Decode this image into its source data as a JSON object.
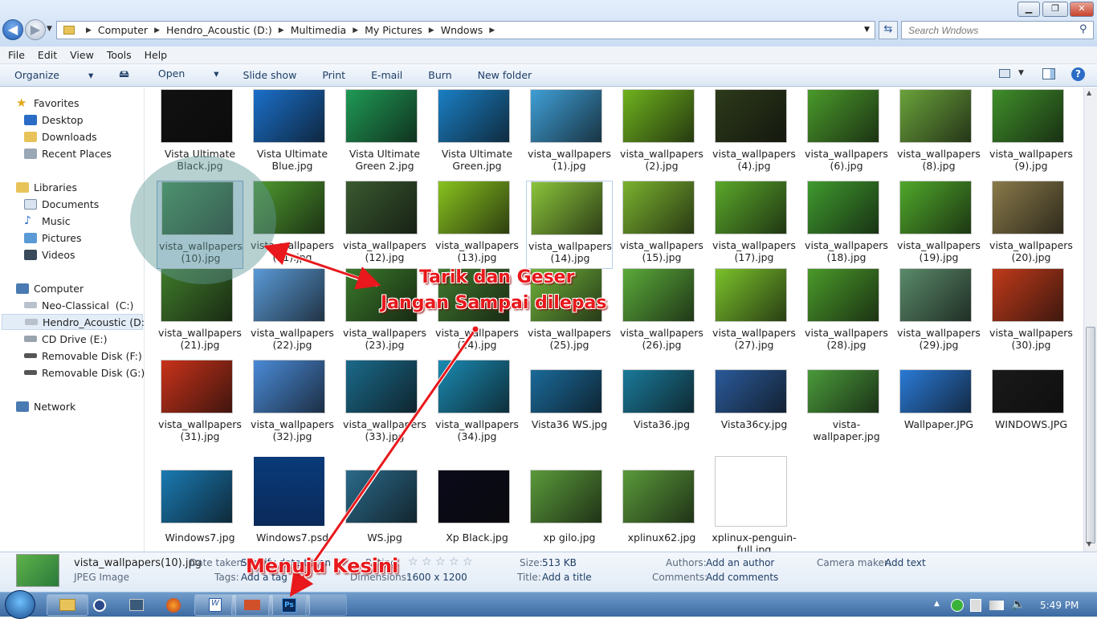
{
  "breadcrumb": [
    "Computer",
    "Hendro_Acoustic (D:)",
    "Multimedia",
    "My Pictures",
    "Wndows"
  ],
  "search_placeholder": "Search Wndows",
  "window_buttons": {
    "min": "▁",
    "max": "❐",
    "close": "✕"
  },
  "menu": [
    "File",
    "Edit",
    "View",
    "Tools",
    "Help"
  ],
  "commands": [
    "Organize",
    "Open",
    "Slide show",
    "Print",
    "E-mail",
    "Burn",
    "New folder"
  ],
  "nav": {
    "favorites": "Favorites",
    "desktop": "Desktop",
    "downloads": "Downloads",
    "recent": "Recent Places",
    "libraries": "Libraries",
    "documents": "Documents",
    "music": "Music",
    "pictures": "Pictures",
    "videos": "Videos",
    "computer": "Computer",
    "c": "Neo-Classical  (C:)",
    "d": "Hendro_Acoustic (D:)",
    "e": "CD Drive (E:)",
    "f": "Removable Disk (F:)",
    "g": "Removable Disk (G:)",
    "network": "Network"
  },
  "files": [
    [
      "Vista Ultimate Black.jpg",
      "Vista Ultimate Blue.jpg",
      "Vista Ultimate Green 2.jpg",
      "Vista Ultimate Green.jpg",
      "vista_wallpapers(1).jpg",
      "vista_wallpapers(2).jpg",
      "vista_wallpapers(4).jpg",
      "vista_wallpapers(6).jpg",
      "vista_wallpapers(8).jpg",
      "vista_wallpapers(9).jpg"
    ],
    [
      "vista_wallpapers(10).jpg",
      "vista_wallpapers(11).jpg",
      "vista_wallpapers(12).jpg",
      "vista_wallpapers(13).jpg",
      "vista_wallpapers(14).jpg",
      "vista_wallpapers(15).jpg",
      "vista_wallpapers(17).jpg",
      "vista_wallpapers(18).jpg",
      "vista_wallpapers(19).jpg",
      "vista_wallpapers(20).jpg"
    ],
    [
      "vista_wallpapers(21).jpg",
      "vista_wallpapers(22).jpg",
      "vista_wallpapers(23).jpg",
      "vista_wallpapers(24).jpg",
      "vista_wallpapers(25).jpg",
      "vista_wallpapers(26).jpg",
      "vista_wallpapers(27).jpg",
      "vista_wallpapers(28).jpg",
      "vista_wallpapers(29).jpg",
      "vista_wallpapers(30).jpg"
    ],
    [
      "vista_wallpapers(31).jpg",
      "vista_wallpapers(32).jpg",
      "vista_wallpapers(33).jpg",
      "vista_wallpapers(34).jpg",
      "Vista36 WS.jpg",
      "Vista36.jpg",
      "Vista36cy.jpg",
      "vista-wallpaper.jpg",
      "Wallpaper.JPG",
      "WINDOWS.JPG"
    ],
    [
      "Windows7.jpg",
      "Windows7.psd",
      "WS.jpg",
      "Xp Black.jpg",
      "xp gilo.jpg",
      "xplinux62.jpg",
      "xplinux-penguin-full.jpg"
    ]
  ],
  "thumb_colors": [
    [
      "#111111",
      "#1a6fc9",
      "#1f9a55",
      "#1a7fc4",
      "#3f9fd6",
      "#6fb21e",
      "#2d3a1a",
      "#4a9a2a",
      "#6aa23a",
      "#3f8f2a"
    ],
    [
      "#3e8f4e",
      "#4e9a2e",
      "#3a5a30",
      "#88c21e",
      "#8ac43a",
      "#7ab22e",
      "#5aa82a",
      "#3f9a2e",
      "#4fa82a",
      "#8a7a4a"
    ],
    [
      "#3f7a2a",
      "#5a9ad6",
      "#3a7a2a",
      "#3f7a2e",
      "#6fb23a",
      "#5aaa3a",
      "#7ac22a",
      "#4a9a2a",
      "#5a8a6a",
      "#c03a1a"
    ],
    [
      "#c8321a",
      "#4a8ad6",
      "#1a6a8a",
      "#1a8ab2",
      "#1a6a9a",
      "#1a7a9a",
      "#2a5a9a",
      "#4a9a3a",
      "#2a7ad6",
      "#1a1a1a"
    ],
    [
      "#1a7ab2",
      "#1a4a8a",
      "#2a6a8a",
      "#0a0a1a",
      "#5a9a3a",
      "#5a9a3a",
      "#ffffff"
    ]
  ],
  "details": {
    "filename": "vista_wallpapers(10).jpg",
    "filetype": "JPEG Image",
    "date_taken_k": "Date taken:",
    "date_taken_v": "Specify date taken",
    "tags_k": "Tags:",
    "tags_v": "Add a tag",
    "rating_k": "Rating:",
    "rating_v": "☆ ☆ ☆ ☆ ☆",
    "dim_k": "Dimensions:",
    "dim_v": "1600 x 1200",
    "size_k": "Size:",
    "size_v": "513 KB",
    "title_k": "Title:",
    "title_v": "Add a title",
    "authors_k": "Authors:",
    "authors_v": "Add an author",
    "comments_k": "Comments:",
    "comments_v": "Add comments",
    "camera_k": "Camera maker:",
    "camera_v": "Add text"
  },
  "annotations": {
    "a1": "Tarik dan Geser",
    "a2": "Jangan Sampai dilepas",
    "a3": "Menuju Kesini"
  },
  "taskbar": {
    "clock": "5:49 PM",
    "ps_label": "Ps"
  },
  "icons": [
    "search-icon",
    "back-icon",
    "forward-icon",
    "folder-icon",
    "star-icon",
    "drive-icon",
    "network-icon",
    "help-icon",
    "start-orb-icon"
  ]
}
